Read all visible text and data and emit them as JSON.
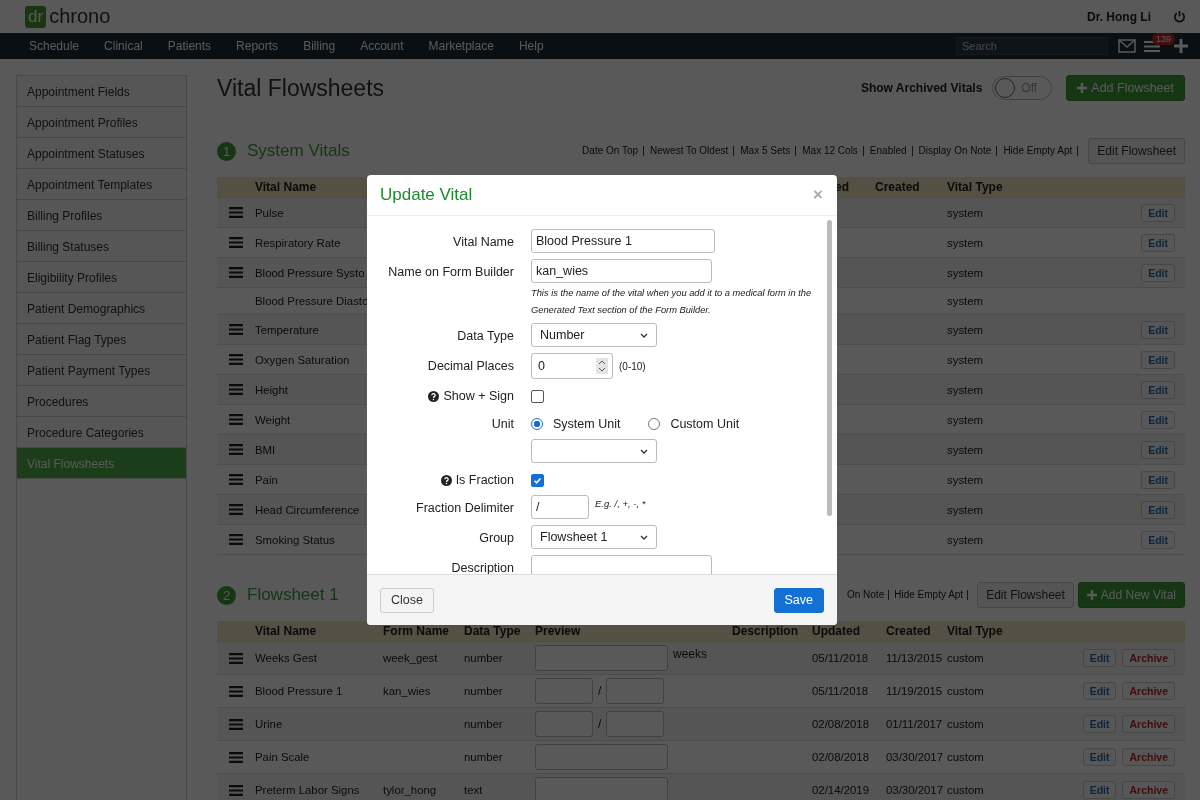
{
  "app": {
    "logo_mark": "dr",
    "logo_text": "chrono",
    "user": "Dr. Hong Li"
  },
  "nav": {
    "items": [
      "Schedule",
      "Clinical",
      "Patients",
      "Reports",
      "Billing",
      "Account",
      "Marketplace",
      "Help"
    ],
    "search_placeholder": "Search",
    "badge": "139"
  },
  "sidebar": {
    "items": [
      {
        "label": "Appointment Fields",
        "selected": false
      },
      {
        "label": "Appointment Profiles",
        "selected": false
      },
      {
        "label": "Appointment Statuses",
        "selected": false
      },
      {
        "label": "Appointment Templates",
        "selected": false
      },
      {
        "label": "Billing Profiles",
        "selected": false
      },
      {
        "label": "Billing Statuses",
        "selected": false
      },
      {
        "label": "Eligibility Profiles",
        "selected": false
      },
      {
        "label": "Patient Demographics",
        "selected": false
      },
      {
        "label": "Patient Flag Types",
        "selected": false
      },
      {
        "label": "Patient Payment Types",
        "selected": false
      },
      {
        "label": "Procedures",
        "selected": false
      },
      {
        "label": "Procedure Categories",
        "selected": false
      },
      {
        "label": "Vital Flowsheets",
        "selected": true
      }
    ]
  },
  "page": {
    "title": "Vital Flowsheets",
    "archived_toggle": {
      "label": "Show Archived Vitals",
      "on": false,
      "state_text": "Off"
    },
    "add_button": "Add Flowsheet"
  },
  "system_section": {
    "number": "1",
    "title": "System Vitals",
    "settings": [
      "Date On Top",
      "Newest To Oldest",
      "Max 5 Sets",
      "Max 12 Cols",
      "Enabled",
      "Display On Note",
      "Hide Empty Apt"
    ],
    "edit_button": "Edit Flowsheet",
    "columns": [
      "Vital Name",
      "ed",
      "Created",
      "Vital Type"
    ],
    "rows": [
      {
        "name": "Pulse",
        "type": "system",
        "draggable": true,
        "edit": "Edit"
      },
      {
        "name": "Respiratory Rate",
        "type": "system",
        "draggable": true,
        "edit": "Edit"
      },
      {
        "name": "Blood Pressure Systo",
        "type": "system",
        "draggable": true,
        "edit": "Edit"
      },
      {
        "name": "Blood Pressure Diasto",
        "type": "system",
        "draggable": false
      },
      {
        "name": "Temperature",
        "type": "system",
        "draggable": true,
        "edit": "Edit"
      },
      {
        "name": "Oxygen Saturation",
        "type": "system",
        "draggable": true,
        "edit": "Edit"
      },
      {
        "name": "Height",
        "type": "system",
        "draggable": true,
        "edit": "Edit"
      },
      {
        "name": "Weight",
        "type": "system",
        "draggable": true,
        "edit": "Edit"
      },
      {
        "name": "BMI",
        "type": "system",
        "draggable": true,
        "edit": "Edit"
      },
      {
        "name": "Pain",
        "type": "system",
        "draggable": true,
        "edit": "Edit"
      },
      {
        "name": "Head Circumference",
        "type": "system",
        "draggable": true,
        "edit": "Edit"
      },
      {
        "name": "Smoking Status",
        "type": "system",
        "draggable": true,
        "edit": "Edit"
      }
    ]
  },
  "flowsheet_section": {
    "number": "2",
    "title": "Flowsheet 1",
    "settings": [
      "On Note",
      "Hide Empty Apt"
    ],
    "edit_button": "Edit Flowsheet",
    "add_button": "Add New Vital",
    "columns": [
      "Vital Name",
      "Form Name",
      "Data Type",
      "Preview",
      "Description",
      "Updated",
      "Created",
      "Vital Type"
    ],
    "rows": [
      {
        "name": "Weeks Gest",
        "form_name": "week_gest",
        "data_type": "number",
        "preview": {
          "kind": "single",
          "unit": "weeks"
        },
        "updated": "05/11/2018",
        "created": "11/13/2015",
        "type": "custom",
        "edit": "Edit",
        "archive": "Archive"
      },
      {
        "name": "Blood Pressure 1",
        "form_name": "kan_wies",
        "data_type": "number",
        "preview": {
          "kind": "fraction",
          "delimiter": "/"
        },
        "updated": "05/11/2018",
        "created": "11/19/2015",
        "type": "custom",
        "edit": "Edit",
        "archive": "Archive"
      },
      {
        "name": "Urine",
        "data_type": "number",
        "preview": {
          "kind": "fraction",
          "delimiter": "/"
        },
        "updated": "02/08/2018",
        "created": "01/11/2017",
        "type": "custom",
        "edit": "Edit",
        "archive": "Archive"
      },
      {
        "name": "Pain Scale",
        "data_type": "number",
        "preview": {
          "kind": "single"
        },
        "updated": "02/08/2018",
        "created": "03/30/2017",
        "type": "custom",
        "edit": "Edit",
        "archive": "Archive"
      },
      {
        "name": "Preterm Labor Signs",
        "form_name": "tylor_hong",
        "data_type": "text",
        "preview": {
          "kind": "single"
        },
        "updated": "02/14/2019",
        "created": "03/30/2017",
        "type": "custom",
        "edit": "Edit",
        "archive": "Archive"
      }
    ]
  },
  "modal": {
    "title": "Update Vital",
    "close": "×",
    "fields": [
      {
        "kind": "text",
        "label": "Vital Name",
        "value": "Blood Pressure 1"
      },
      {
        "kind": "text",
        "label": "Name on Form Builder",
        "value": "kan_wies",
        "hint": "This is the name of the vital when you add it to a medical form in the Generated Text section of the Form Builder."
      },
      {
        "kind": "select",
        "label": "Data Type",
        "value": "Number"
      },
      {
        "kind": "number",
        "label": "Decimal Places",
        "value": "0",
        "note": "(0-10)"
      },
      {
        "kind": "checkbox",
        "label": "Show + Sign",
        "help": true,
        "checked": false
      },
      {
        "kind": "radio",
        "label": "Unit",
        "options": [
          {
            "label": "System Unit",
            "selected": true
          },
          {
            "label": "Custom Unit",
            "selected": false
          }
        ]
      },
      {
        "kind": "checkbox",
        "label": "Is Fraction",
        "help": true,
        "checked": true
      },
      {
        "kind": "short",
        "label": "Fraction Delimiter",
        "value": "/",
        "note": "E.g. /, +, -, *"
      },
      {
        "kind": "select",
        "label": "Group",
        "value": "Flowsheet 1"
      },
      {
        "kind": "textarea",
        "label": "Description"
      }
    ],
    "close_button": "Close",
    "save_button": "Save"
  }
}
